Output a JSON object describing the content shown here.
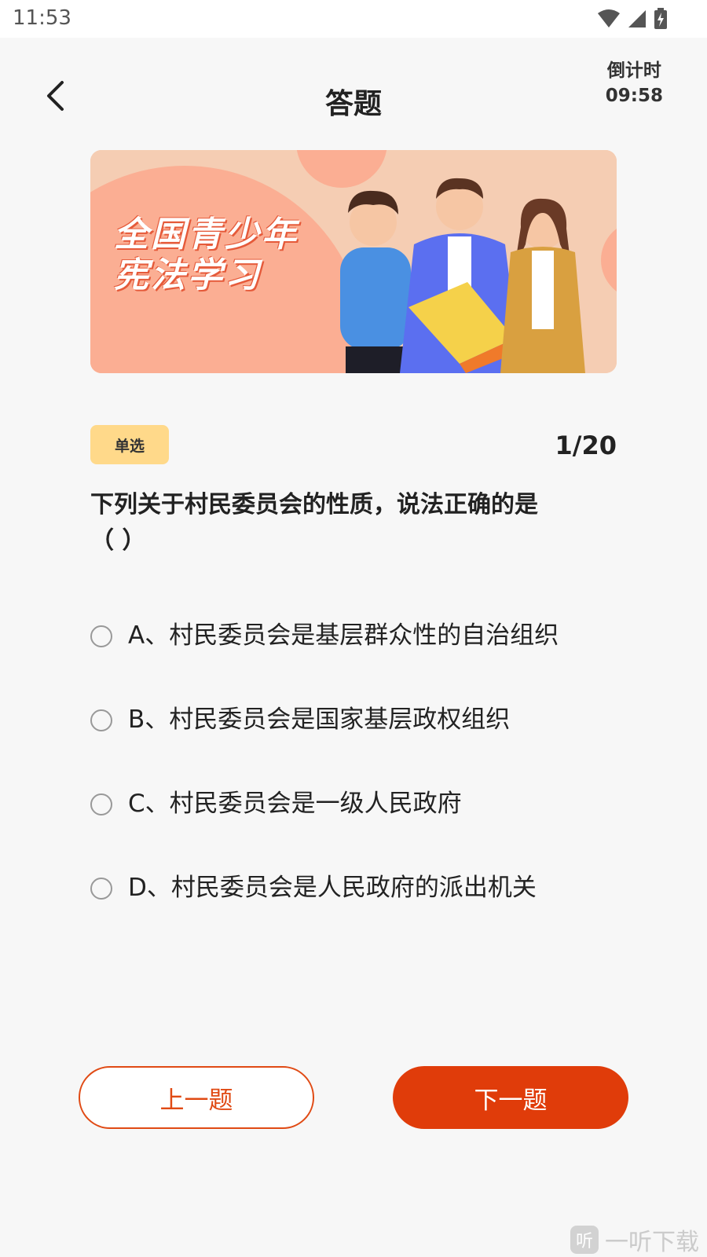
{
  "status_bar": {
    "time": "11:53"
  },
  "header": {
    "title": "答题",
    "countdown_label": "倒计时",
    "countdown_value": "09:58"
  },
  "banner": {
    "line1": "全国青少年",
    "line2": "宪法学习"
  },
  "question": {
    "type_tag": "单选",
    "progress": "1/20",
    "text": "下列关于村民委员会的性质，说法正确的是",
    "blank": "（ ）",
    "options": [
      {
        "label": "A、村民委员会是基层群众性的自治组织"
      },
      {
        "label": "B、村民委员会是国家基层政权组织"
      },
      {
        "label": "C、村民委员会是一级人民政府"
      },
      {
        "label": "D、村民委员会是人民政府的派出机关"
      }
    ]
  },
  "footer": {
    "prev_label": "上一题",
    "next_label": "下一题"
  },
  "watermark": {
    "logo": "听",
    "text": "一听下载"
  },
  "colors": {
    "accent": "#e03c0a",
    "tag_bg": "#ffd98a",
    "banner_bg": "#f5cdb3"
  }
}
